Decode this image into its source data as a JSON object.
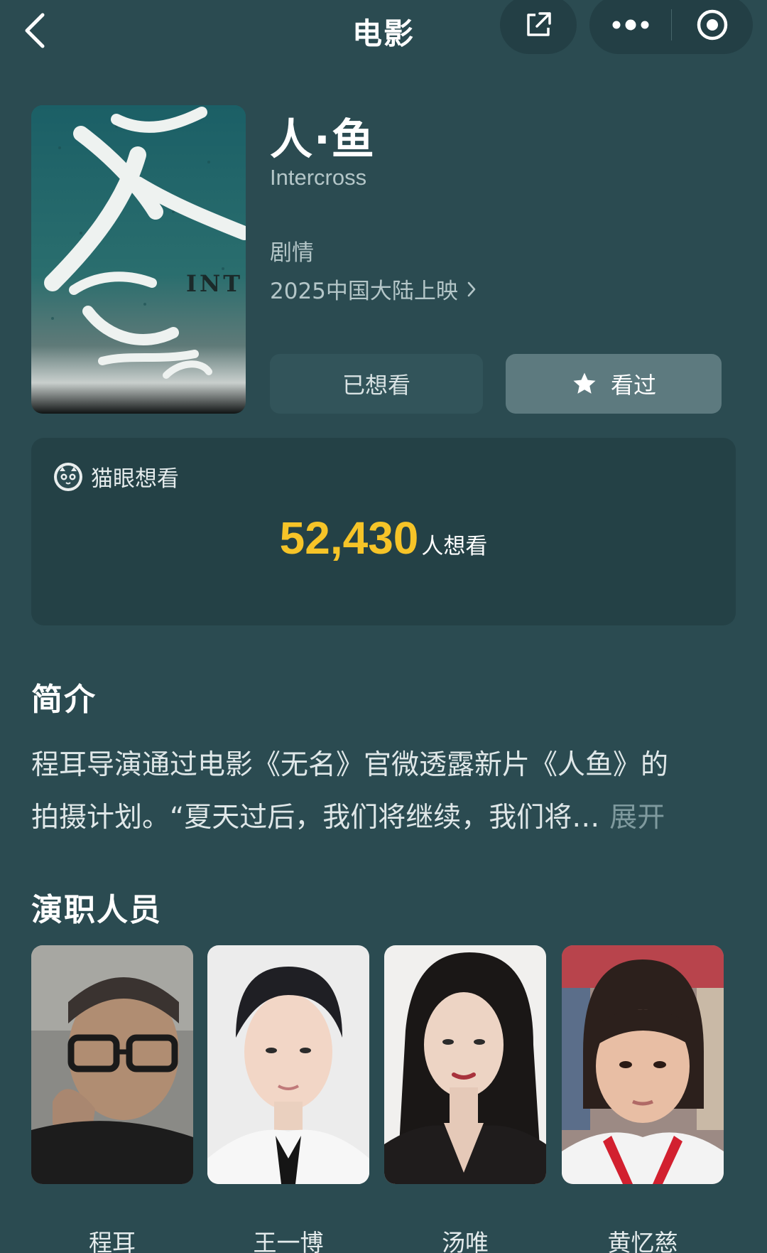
{
  "header": {
    "title": "电影",
    "back_icon": "chevron-left-icon",
    "share_icon": "share-external-icon",
    "more_icon": "more-dots-icon",
    "close_icon": "target-circle-icon"
  },
  "movie": {
    "title": "人·鱼",
    "english_title": "Intercross",
    "genre": "剧情",
    "release": "2025中国大陆上映",
    "release_chevron": "›",
    "poster": {
      "text_big": "人鱼",
      "text_small": "INT"
    }
  },
  "actions": {
    "wish_label": "已想看",
    "seen_label": "看过",
    "seen_icon": "star-icon"
  },
  "want": {
    "source_label": "猫眼想看",
    "count": "52,430",
    "unit": "人想看"
  },
  "synopsis": {
    "title": "简介",
    "line1": "程耳导演通过电影《无名》官微透露新片《人鱼》的",
    "line2": "拍摄计划。“夏天过后，我们将继续，我们将…",
    "expand_label": "展开"
  },
  "cast": {
    "title": "演职人员",
    "members": [
      {
        "name": "程耳"
      },
      {
        "name": "王一博"
      },
      {
        "name": "汤唯"
      },
      {
        "name": "黄忆慈"
      }
    ]
  },
  "colors": {
    "background": "#2b4b51",
    "card": "#244146",
    "accent": "#f6c428"
  }
}
